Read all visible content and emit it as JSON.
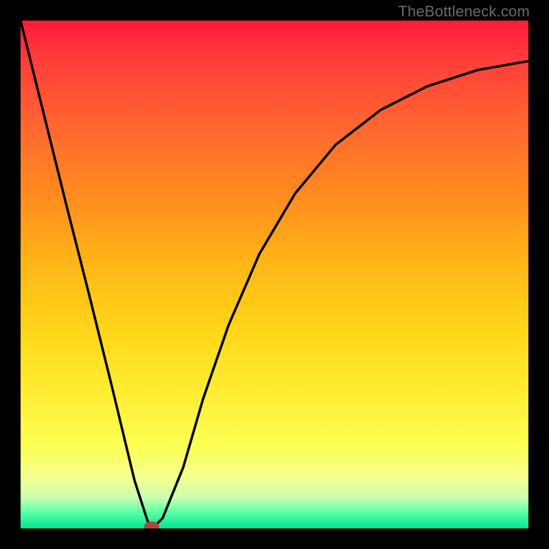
{
  "watermark": "TheBottleneck.com",
  "chart_data": {
    "type": "line",
    "title": "",
    "xlabel": "",
    "ylabel": "",
    "xlim": [
      0,
      1
    ],
    "ylim": [
      0,
      1
    ],
    "grid": false,
    "legend": false,
    "series": [
      {
        "name": "curve",
        "x": [
          0.0,
          0.045,
          0.09,
          0.135,
          0.18,
          0.225,
          0.25,
          0.26,
          0.28,
          0.32,
          0.36,
          0.41,
          0.47,
          0.54,
          0.62,
          0.71,
          0.8,
          0.9,
          1.0
        ],
        "y": [
          1.0,
          0.82,
          0.64,
          0.46,
          0.28,
          0.095,
          0.015,
          0.0,
          0.02,
          0.12,
          0.255,
          0.4,
          0.54,
          0.66,
          0.755,
          0.825,
          0.87,
          0.902,
          0.92
        ]
      }
    ],
    "marker": {
      "x": 0.258,
      "y": 0.004,
      "color": "#b5443e"
    },
    "gradient_stops": [
      {
        "pos": 0.0,
        "color": "#ff1a3a"
      },
      {
        "pos": 0.08,
        "color": "#ff3e3a"
      },
      {
        "pos": 0.22,
        "color": "#ff6a2f"
      },
      {
        "pos": 0.34,
        "color": "#ff8a1f"
      },
      {
        "pos": 0.48,
        "color": "#ffb617"
      },
      {
        "pos": 0.62,
        "color": "#ffd81a"
      },
      {
        "pos": 0.76,
        "color": "#fff23a"
      },
      {
        "pos": 0.84,
        "color": "#fcff55"
      },
      {
        "pos": 0.9,
        "color": "#f4ff8f"
      },
      {
        "pos": 0.94,
        "color": "#c8ffb0"
      },
      {
        "pos": 0.97,
        "color": "#53ffa6"
      },
      {
        "pos": 1.0,
        "color": "#00e690"
      }
    ]
  }
}
